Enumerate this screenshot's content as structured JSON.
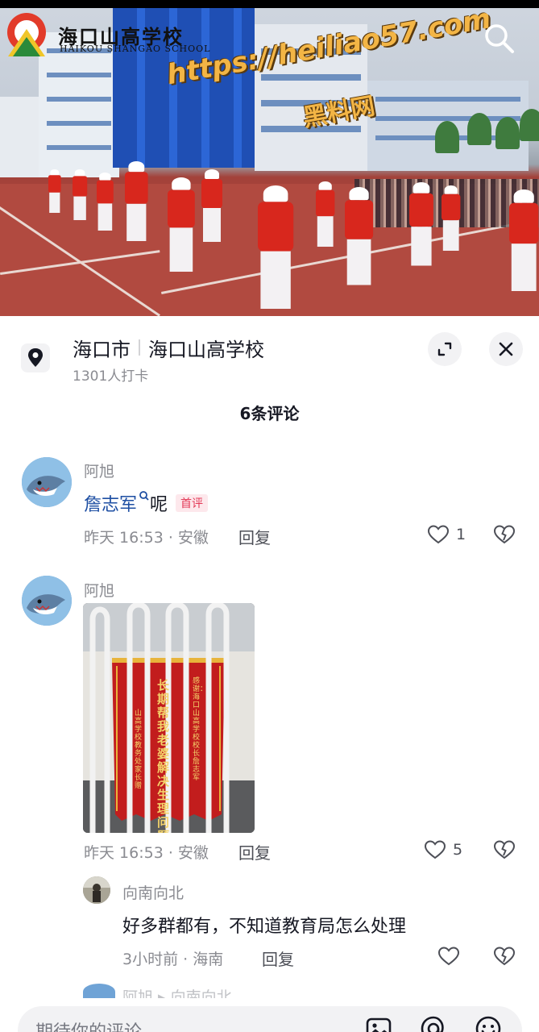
{
  "video": {
    "logo_text": "海口山高学校",
    "logo_sub": "HAIKOU SHANGAO SCHOOL",
    "watermark_url": "https://heiliao57.com",
    "watermark_cn": "黑料网"
  },
  "location": {
    "city": "海口市",
    "place": "海口山高学校",
    "checkins": "1301人打卡"
  },
  "comments_title": "6条评论",
  "comments": [
    {
      "author": "阿旭",
      "mention": "詹志军",
      "text": "呢",
      "badge": "首评",
      "meta": "昨天 16:53 · 安徽",
      "reply": "回复",
      "likes": "1"
    },
    {
      "author": "阿旭",
      "meta": "昨天 16:53 · 安徽",
      "reply": "回复",
      "likes": "5",
      "banner_left": "长期帮我老婆解决生理问题",
      "banner_right": "感谢：海口山高学校校长 詹志军",
      "banner_side": "山高学校教务处 家长赠"
    }
  ],
  "reply_comment": {
    "author": "向南向北",
    "text": "好多群都有，不知道教育局怎么处理",
    "meta": "3小时前 · 海南",
    "reply": "回复"
  },
  "partial_next": "阿旭 ▸ 向南向北",
  "input": {
    "placeholder": "期待你的评论"
  },
  "icons": [
    "search-icon",
    "location-pin-icon",
    "expand-icon",
    "close-icon",
    "heart-icon",
    "broken-heart-icon",
    "image-icon",
    "at-icon",
    "emoji-icon"
  ]
}
